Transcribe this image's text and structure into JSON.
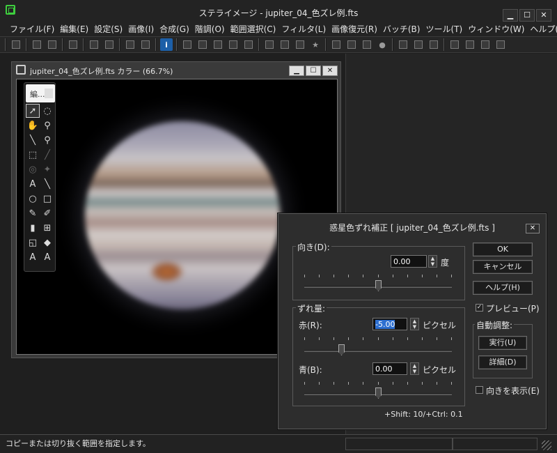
{
  "app": {
    "title": "ステライメージ - jupiter_04_色ズレ例.fts",
    "minimize": "▁",
    "maximize": "☐",
    "close": "✕"
  },
  "menu": [
    "ファイル(F)",
    "編集(E)",
    "設定(S)",
    "画像(I)",
    "合成(G)",
    "階調(O)",
    "範囲選択(C)",
    "フィルタ(L)",
    "画像復元(R)",
    "バッチ(B)",
    "ツール(T)",
    "ウィンドウ(W)",
    "ヘルプ(H)"
  ],
  "document": {
    "title": "jupiter_04_色ズレ例.fts カラー (66.7%)",
    "min": "▁",
    "max": "☐",
    "close": "✕"
  },
  "palette": {
    "tab": "編..."
  },
  "dialog": {
    "title": "惑星色ずれ補正 [ jupiter_04_色ズレ例.fts ]",
    "close": "✕",
    "direction_group": "向き(D):",
    "direction_value": "0.00",
    "direction_unit": "度",
    "shift_group": "ずれ量:",
    "red_label": "赤(R):",
    "red_value": "-5.00",
    "red_unit": "ピクセル",
    "blue_label": "青(B):",
    "blue_value": "0.00",
    "blue_unit": "ピクセル",
    "hint": "+Shift: 10/+Ctrl: 0.1",
    "ok": "OK",
    "cancel": "キャンセル",
    "help": "ヘルプ(H)",
    "preview": "プレビュー(P)",
    "auto_group": "自動調整:",
    "execute": "実行(U)",
    "details": "詳細(D)",
    "show_direction": "向きを表示(E)",
    "preview_checked": true,
    "show_direction_checked": false,
    "direction_slider": 0.5,
    "red_slider": 0.25,
    "blue_slider": 0.5
  },
  "status": {
    "text": "コピーまたは切り抜く範囲を指定します。"
  }
}
